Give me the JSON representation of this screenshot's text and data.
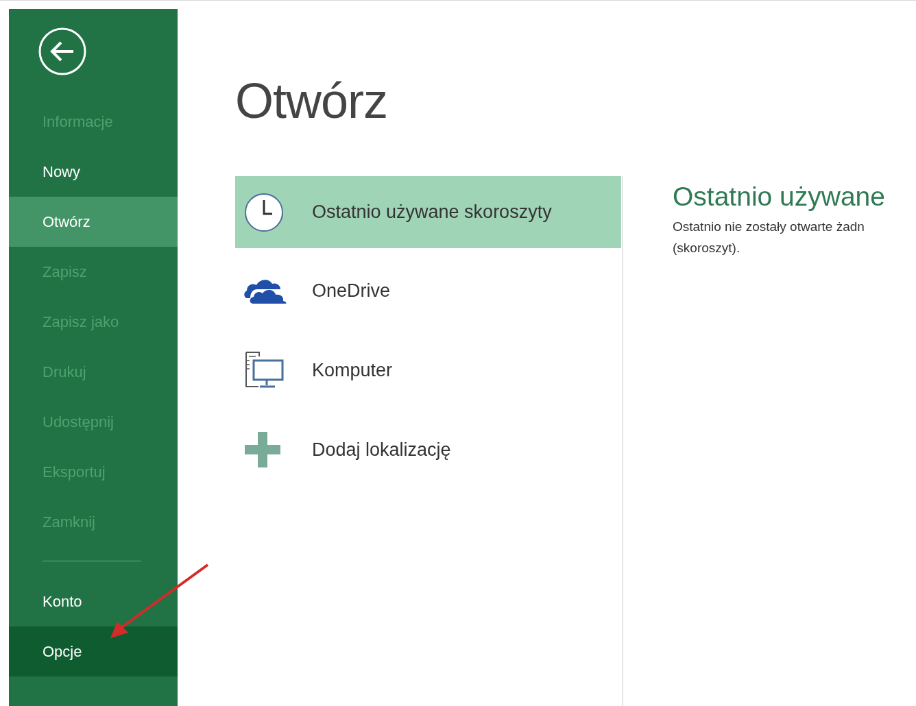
{
  "sidebar": {
    "items": [
      {
        "label": "Informacje",
        "disabled": true,
        "selected": false,
        "highlighted": false
      },
      {
        "label": "Nowy",
        "disabled": false,
        "selected": false,
        "highlighted": false
      },
      {
        "label": "Otwórz",
        "disabled": false,
        "selected": true,
        "highlighted": false
      },
      {
        "label": "Zapisz",
        "disabled": true,
        "selected": false,
        "highlighted": false
      },
      {
        "label": "Zapisz jako",
        "disabled": true,
        "selected": false,
        "highlighted": false
      },
      {
        "label": "Drukuj",
        "disabled": true,
        "selected": false,
        "highlighted": false
      },
      {
        "label": "Udostępnij",
        "disabled": true,
        "selected": false,
        "highlighted": false
      },
      {
        "label": "Eksportuj",
        "disabled": true,
        "selected": false,
        "highlighted": false
      },
      {
        "label": "Zamknij",
        "disabled": true,
        "selected": false,
        "highlighted": false
      }
    ],
    "bottom_items": [
      {
        "label": "Konto",
        "disabled": false,
        "selected": false,
        "highlighted": false
      },
      {
        "label": "Opcje",
        "disabled": false,
        "selected": false,
        "highlighted": true
      }
    ]
  },
  "page_title": "Otwórz",
  "places": [
    {
      "kind": "recent",
      "label": "Ostatnio używane skoroszyty",
      "selected": true
    },
    {
      "kind": "cloud",
      "label": "OneDrive",
      "selected": false
    },
    {
      "kind": "computer",
      "label": "Komputer",
      "selected": false
    },
    {
      "kind": "add",
      "label": "Dodaj lokalizację",
      "selected": false
    }
  ],
  "detail": {
    "heading": "Ostatnio używane",
    "message_lines": [
      "Ostatnio nie zostały otwarte żadn",
      "(skoroszyt)."
    ]
  }
}
